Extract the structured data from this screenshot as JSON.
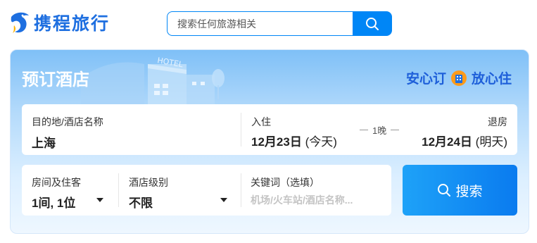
{
  "brand": {
    "logo_text": "携程旅行",
    "logo_icon": "dolphin-logo-icon",
    "color": "#1e6fe0"
  },
  "search": {
    "placeholder": "搜索任何旅游相关",
    "button_icon": "search-icon"
  },
  "hotel_booking": {
    "title": "预订酒店",
    "slogan_left": "安心订",
    "slogan_icon": "shield-hotel-icon",
    "slogan_right": "放心住",
    "destination": {
      "label": "目的地/酒店名称",
      "value": "上海"
    },
    "checkin": {
      "label": "入住",
      "date": "12月23日",
      "note": "(今天)"
    },
    "nights": "1晚",
    "checkout": {
      "label": "退房",
      "date": "12月24日",
      "note": "(明天)"
    },
    "rooms_guests": {
      "label": "房间及住客",
      "value": "1间, 1位"
    },
    "star_level": {
      "label": "酒店级别",
      "value": "不限"
    },
    "keyword": {
      "label": "关键词（选填）",
      "placeholder": "机场/火车站/酒店名称..."
    },
    "search_button": "搜索"
  },
  "colors": {
    "primary": "#0086f6",
    "slogan": "#1e5fd9"
  }
}
